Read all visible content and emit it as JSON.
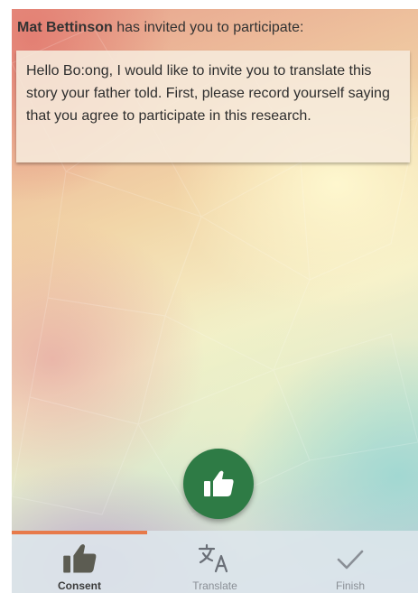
{
  "invitation": {
    "sender": "Mat Bettinson",
    "text": "has invited you to participate:",
    "message": "Hello Bo:ong, I would like to invite you to translate this story your father told. First, please record yourself saying that you agree to participate in this research."
  },
  "action_button": {
    "icon": "thumbs-up-icon",
    "color": "#2e7b45"
  },
  "bottom_nav": {
    "active_index": 0,
    "indicator_color": "#e77a4a",
    "items": [
      {
        "label": "Consent",
        "icon": "thumbs-up-icon"
      },
      {
        "label": "Translate",
        "icon": "translate-icon"
      },
      {
        "label": "Finish",
        "icon": "check-icon"
      }
    ]
  }
}
